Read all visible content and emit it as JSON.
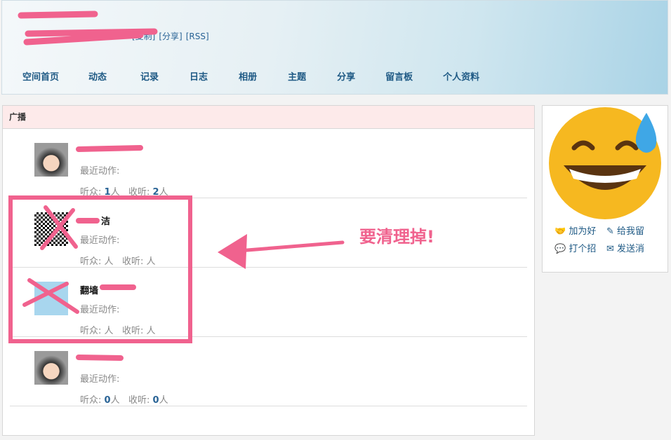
{
  "header": {
    "links": [
      "[复制]",
      "[分享]",
      "[RSS]"
    ]
  },
  "nav": [
    "空间首页",
    "动态",
    "记录",
    "日志",
    "相册",
    "主题",
    "分享",
    "留言板",
    "个人资料"
  ],
  "panel": {
    "title": "广播"
  },
  "rows": [
    {
      "name": "",
      "action_label": "最近动作:",
      "listeners_label": "听众:",
      "listeners": "1",
      "following_label": "收听:",
      "following": "2",
      "unit": "人",
      "avatar": "cartoon-boy"
    },
    {
      "name": "洁",
      "action_label": "最近动作:",
      "listeners_label": "听众:",
      "listeners": "",
      "following_label": "收听:",
      "following": "",
      "unit": "人",
      "avatar": "qr-code"
    },
    {
      "name": "翻墙",
      "action_label": "最近动作:",
      "listeners_label": "听众:",
      "listeners": "",
      "following_label": "收听:",
      "following": "",
      "unit": "人",
      "avatar": "git-io"
    },
    {
      "name": "",
      "action_label": "最近动作:",
      "listeners_label": "听众:",
      "listeners": "0",
      "following_label": "收听:",
      "following": "0",
      "unit": "人",
      "avatar": "cartoon-boy"
    }
  ],
  "sidebar": {
    "links": [
      "加为好",
      "给我留",
      "打个招",
      "发送消"
    ]
  },
  "annotation": {
    "text": "要清理掉!",
    "color": "#f0628e"
  }
}
